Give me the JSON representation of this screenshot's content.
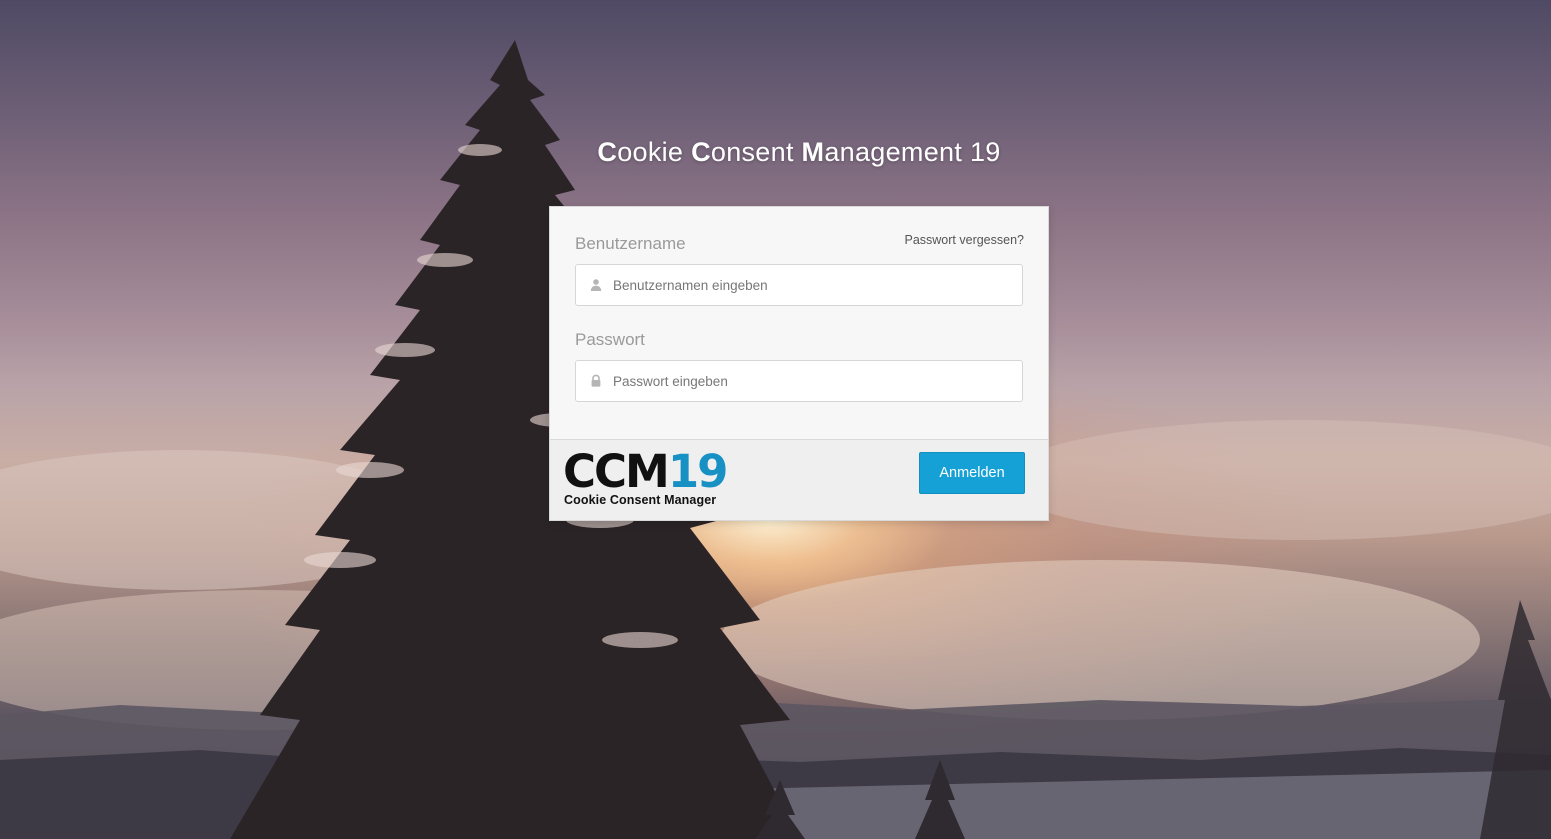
{
  "title": {
    "parts": [
      {
        "initial": "C",
        "rest": "ookie "
      },
      {
        "initial": "C",
        "rest": "onsent "
      },
      {
        "initial": "M",
        "rest": "anagement 19"
      }
    ]
  },
  "login": {
    "username_label": "Benutzername",
    "forgot_password_link": "Passwort vergessen?",
    "username_placeholder": "Benutzernamen eingeben",
    "username_value": "",
    "password_label": "Passwort",
    "password_placeholder": "Passwort eingeben",
    "password_value": "",
    "submit_label": "Anmelden"
  },
  "logo": {
    "letters": "CCM",
    "number": "19",
    "subtitle": "Cookie Consent Manager",
    "accent_color": "#1790c4"
  },
  "colors": {
    "button": "#15a1d6",
    "card": "#f7f7f7",
    "footer": "#efefef"
  },
  "icons": {
    "username": "user-icon",
    "password": "lock-icon"
  }
}
